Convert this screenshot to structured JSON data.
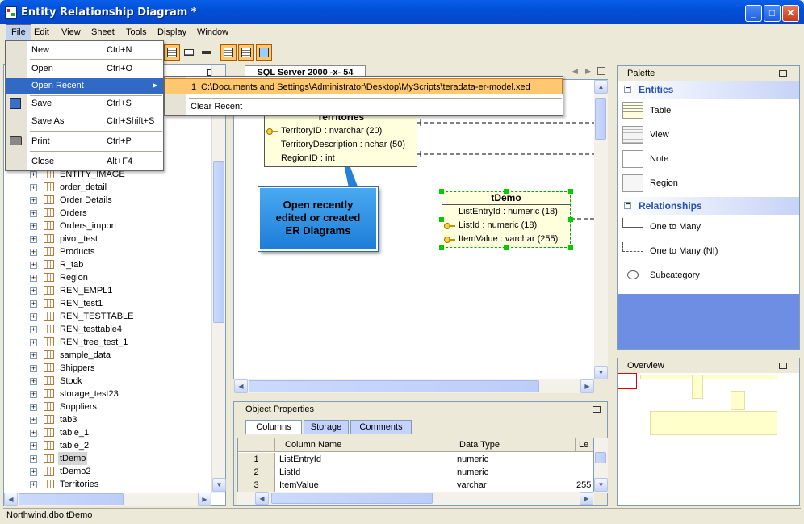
{
  "window": {
    "title": "Entity Relationship Diagram *"
  },
  "menubar": [
    "File",
    "Edit",
    "View",
    "Sheet",
    "Tools",
    "Display",
    "Window"
  ],
  "file_menu": [
    {
      "label": "New",
      "shortcut": "Ctrl+N"
    },
    {
      "label": "Open",
      "shortcut": "Ctrl+O"
    },
    {
      "label": "Open Recent",
      "shortcut": ""
    },
    {
      "label": "Save",
      "shortcut": "Ctrl+S"
    },
    {
      "label": "Save As",
      "shortcut": "Ctrl+Shift+S"
    },
    {
      "label": "Print",
      "shortcut": "Ctrl+P"
    },
    {
      "label": "Close",
      "shortcut": "Alt+F4"
    }
  ],
  "recent_menu": {
    "item_number": "1",
    "item_path": "C:\\Documents and Settings\\Administrator\\Desktop\\MyScripts\\teradata-er-model.xed",
    "clear": "Clear Recent"
  },
  "tree": [
    "ENTITY_IMAGE",
    "order_detail",
    "Order Details",
    "Orders",
    "Orders_import",
    "pivot_test",
    "Products",
    "R_tab",
    "Region",
    "REN_EMPL1",
    "REN_test1",
    "REN_TESTTABLE",
    "REN_testtable4",
    "REN_tree_test_1",
    "sample_data",
    "Shippers",
    "Stock",
    "storage_test23",
    "Suppliers",
    "tab3",
    "table_1",
    "table_2",
    "tDemo",
    "tDemo2",
    "Territories"
  ],
  "sheet_tab": "SQL Server 2000 -x- 54",
  "entities": {
    "territories": {
      "title": "Territories",
      "rows": [
        "TerritoryID : nvarchar (20)",
        "TerritoryDescription : nchar (50)",
        "RegionID : int"
      ]
    },
    "tdemo": {
      "title": "tDemo",
      "rows": [
        "ListEntryId : numeric (18)",
        "ListId : numeric (18)",
        "ItemValue : varchar (255)"
      ]
    }
  },
  "callout": {
    "line1": "Open recently",
    "line2": "edited or created",
    "line3": "ER Diagrams"
  },
  "palette": {
    "title": "Palette",
    "entities_head": "Entities",
    "entities": [
      "Table",
      "View",
      "Note",
      "Region"
    ],
    "relationships_head": "Relationships",
    "relationships": [
      "One to Many",
      "One to Many (NI)",
      "Subcategory"
    ]
  },
  "overview": {
    "title": "Overview"
  },
  "props": {
    "title": "Object Properties",
    "tabs": [
      "Columns",
      "Storage",
      "Comments"
    ],
    "headers": [
      "Column Name",
      "Data Type",
      "Le"
    ],
    "rows": [
      {
        "n": "1",
        "name": "ListEntryId",
        "type": "numeric",
        "len": ""
      },
      {
        "n": "2",
        "name": "ListId",
        "type": "numeric",
        "len": ""
      },
      {
        "n": "3",
        "name": "ItemValue",
        "type": "varchar",
        "len": "255"
      }
    ]
  },
  "status": "Northwind.dbo.tDemo"
}
